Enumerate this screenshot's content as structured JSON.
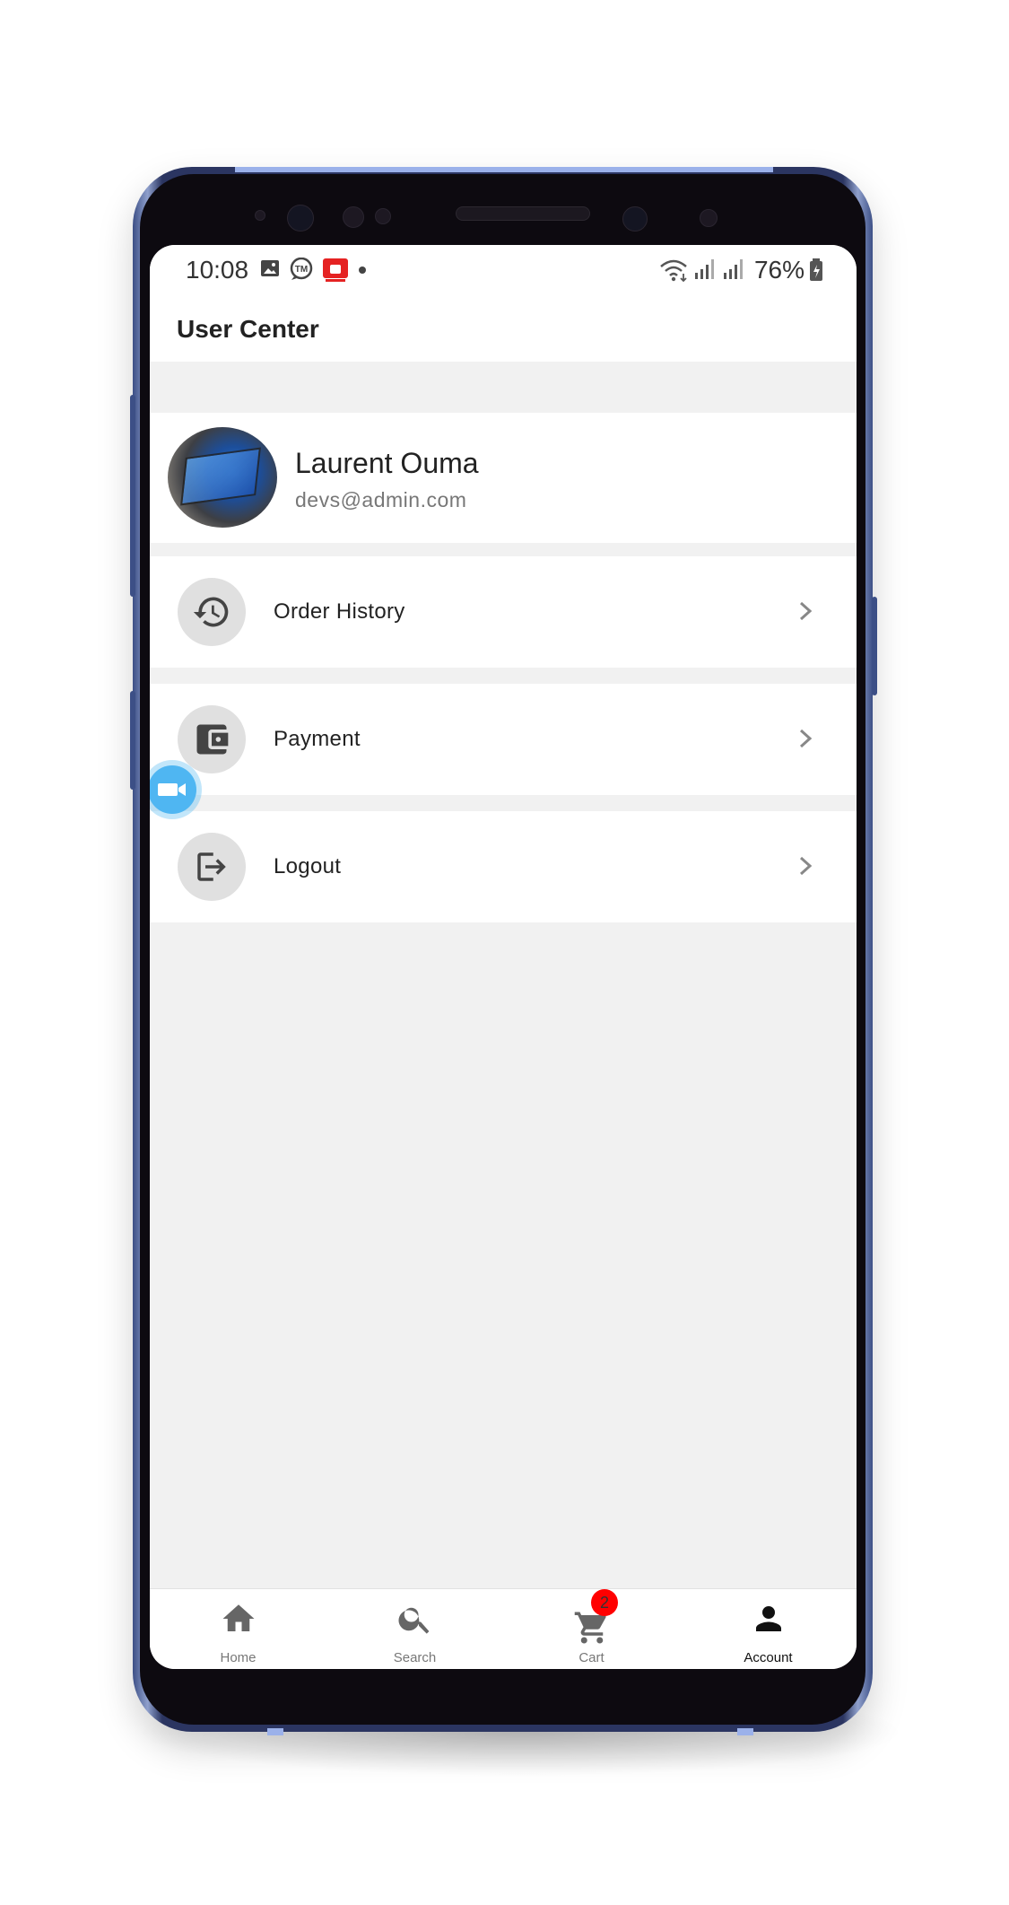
{
  "status_bar": {
    "time": "10:08",
    "battery": "76%",
    "icons": [
      "image-icon",
      "tm-icon",
      "app-notification-icon",
      "dot-icon",
      "wifi-icon",
      "signal-icon",
      "signal-icon",
      "battery-icon"
    ]
  },
  "app_bar": {
    "title": "User Center"
  },
  "profile": {
    "name": "Laurent Ouma",
    "email": "devs@admin.com"
  },
  "menu": {
    "items": [
      {
        "label": "Order History",
        "icon": "history-icon"
      },
      {
        "label": "Payment",
        "icon": "wallet-icon"
      },
      {
        "label": "Logout",
        "icon": "logout-icon"
      }
    ]
  },
  "bottom_nav": {
    "items": [
      {
        "label": "Home",
        "icon": "home-icon"
      },
      {
        "label": "Search",
        "icon": "search-icon"
      },
      {
        "label": "Cart",
        "icon": "cart-icon",
        "badge": "2"
      },
      {
        "label": "Account",
        "icon": "person-icon",
        "active": true
      }
    ]
  },
  "colors": {
    "background": "#f1f1f1",
    "card": "#ffffff",
    "icon_circle": "#e0e0e0",
    "badge": "#ff0000",
    "frame": "#2b3561"
  }
}
